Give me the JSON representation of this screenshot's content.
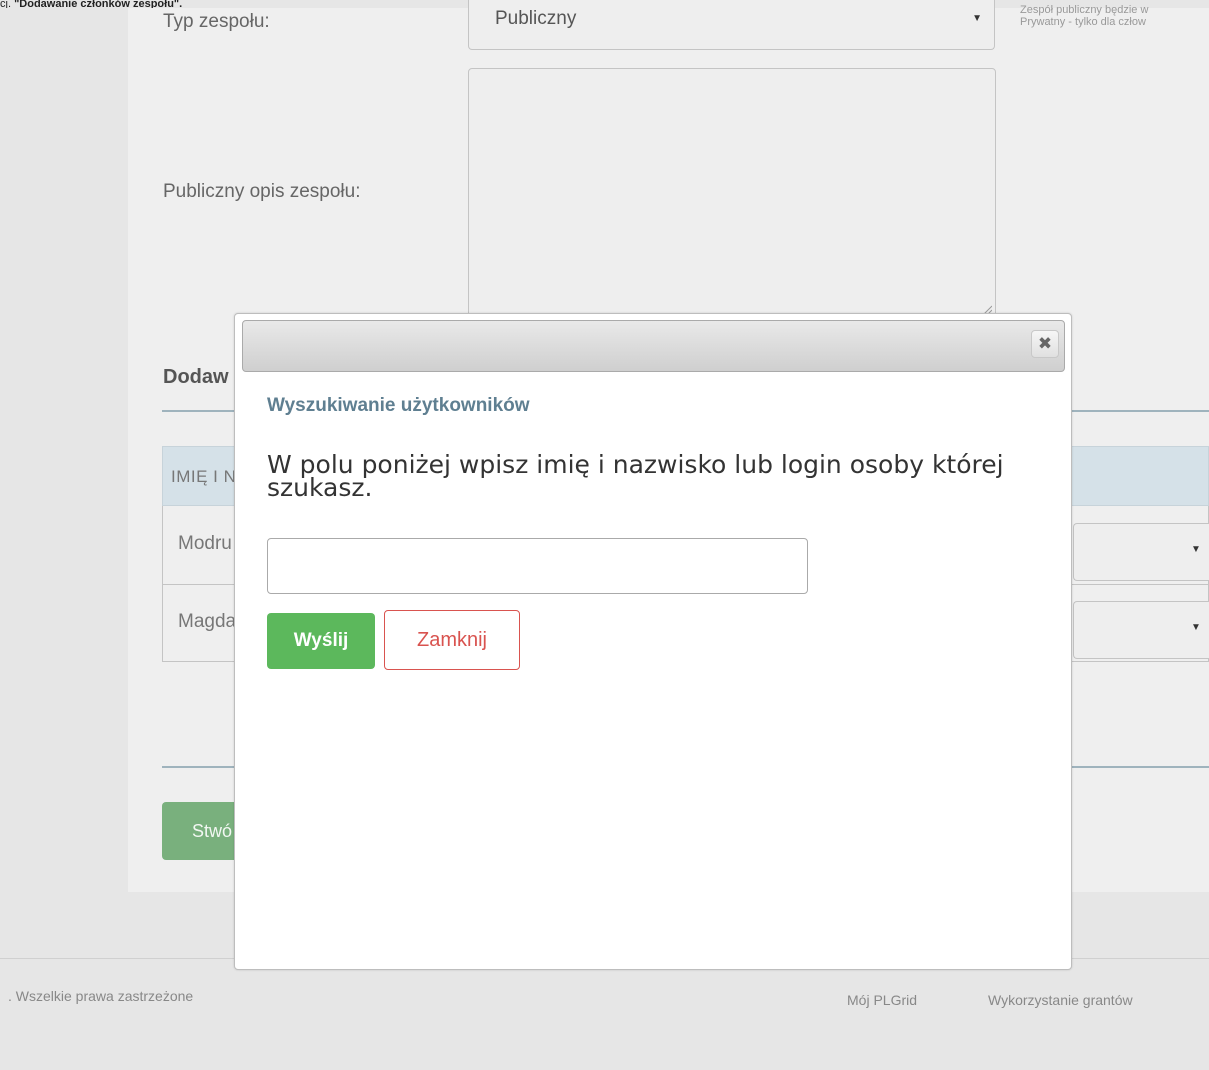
{
  "crop_header": {
    "prefix": "cj.",
    "text": "\"Dodawanie członków zespołu\"."
  },
  "form": {
    "team_type_label": "Typ zespołu:",
    "team_type_value": "Publiczny",
    "team_type_hint_line1": "Zespół publiczny będzie w",
    "team_type_hint_line2": "Prywatny - tylko dla człow",
    "public_description_label": "Publiczny opis zespołu:",
    "public_description_value": ""
  },
  "members_section": {
    "title_visible": "Dodaw",
    "table_header_visible": "IMIĘ I N",
    "rows": [
      {
        "name_visible": "Modru"
      },
      {
        "name_visible": "Magda"
      }
    ]
  },
  "create_button_visible": "Stwó",
  "footer": {
    "copyright_visible": ". Wszelkie prawa zastrzeżone",
    "links": [
      "Mój PLGrid",
      "Wykorzystanie grantów"
    ]
  },
  "modal": {
    "close_glyph": "✖",
    "heading": "Wyszukiwanie użytkowników",
    "instruction": "W polu poniżej wpisz imię i nazwisko lub login osoby której szukasz.",
    "search_value": "",
    "send_label": "Wyślij",
    "close_label": "Zamknij"
  },
  "icons": {
    "select_arrow": "▼"
  },
  "colors": {
    "modal_heading": "#5f7f91",
    "send_button": "#5cb85c",
    "close_button": "#d9534f",
    "table_header_bg": "#d5e1e8"
  }
}
